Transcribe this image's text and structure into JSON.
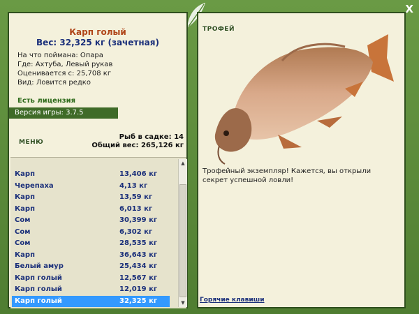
{
  "window": {
    "close_label": "X"
  },
  "fish": {
    "name": "Карп голый",
    "weight": "Вес: 32,325 кг (зачетная)",
    "bait": "На что поймана: Опара",
    "place": "Где: Ахтуба, Левый рукав",
    "value": "Оценивается с: 25,708 кг",
    "rarity": "Вид: Ловится редко"
  },
  "license": "Есть лицензия",
  "version": "Версия игры: 3.7.5",
  "menu_label": "МЕНЮ",
  "stats": {
    "fish_count": "Рыб в садке: 14",
    "total_weight": "Общий вес: 265,126 кг"
  },
  "catch_list": [
    {
      "name": "Карп",
      "weight": "13,406 кг"
    },
    {
      "name": "Черепаха",
      "weight": "4,13 кг"
    },
    {
      "name": "Карп",
      "weight": "13,59 кг"
    },
    {
      "name": "Карп",
      "weight": "6,013 кг"
    },
    {
      "name": "Сом",
      "weight": "30,399 кг"
    },
    {
      "name": "Сом",
      "weight": "6,302 кг"
    },
    {
      "name": "Сом",
      "weight": "28,535 кг"
    },
    {
      "name": "Карп",
      "weight": "36,643 кг"
    },
    {
      "name": "Белый амур",
      "weight": "25,434 кг"
    },
    {
      "name": "Карп голый",
      "weight": "12,567 кг"
    },
    {
      "name": "Карп голый",
      "weight": "12,019 кг"
    },
    {
      "name": "Карп голый",
      "weight": "32,325 кг"
    }
  ],
  "selected_index": 11,
  "trophy": {
    "label": "ТРОФЕЙ",
    "text": "Трофейный экземпляр! Кажется, вы открыли секрет успешной ловли!"
  },
  "hotkeys_label": "Горячие клавиши",
  "colors": {
    "frame": "#5b8a3a",
    "panel": "#f4f1dc",
    "selection": "#3399ff",
    "accent_name": "#b0461a",
    "text_blue": "#1a2f7a"
  }
}
